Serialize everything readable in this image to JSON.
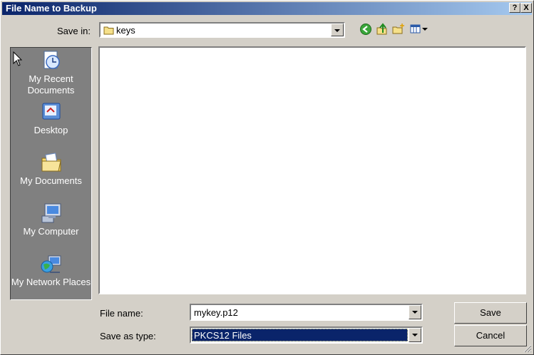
{
  "window": {
    "title": "File Name to Backup",
    "help_glyph": "?",
    "close_glyph": "X"
  },
  "toolbar": {
    "save_in_label": "Save in:",
    "current_folder": "keys",
    "icons": [
      "back-icon",
      "up-folder-icon",
      "new-folder-icon",
      "views-menu-icon"
    ]
  },
  "places": [
    {
      "label": "My Recent Documents",
      "icon": "recent-documents-icon"
    },
    {
      "label": "Desktop",
      "icon": "desktop-icon"
    },
    {
      "label": "My Documents",
      "icon": "my-documents-icon"
    },
    {
      "label": "My Computer",
      "icon": "my-computer-icon"
    },
    {
      "label": "My Network Places",
      "icon": "network-places-icon"
    }
  ],
  "form": {
    "file_name_label": "File name:",
    "file_name_value": "mykey.p12",
    "save_type_label": "Save as type:",
    "save_type_value": "PKCS12 Files"
  },
  "buttons": {
    "save": "Save",
    "cancel": "Cancel"
  },
  "colors": {
    "title_start": "#0a246a",
    "title_end": "#a6caf0",
    "face": "#d4d0c8",
    "selection": "#0a246a",
    "places_bg": "#808080"
  }
}
